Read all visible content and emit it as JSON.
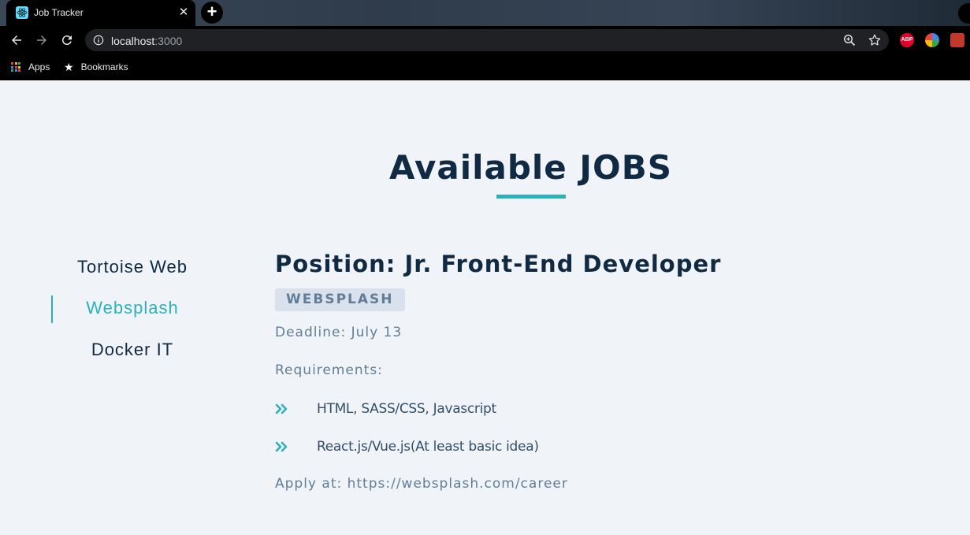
{
  "browser": {
    "tab_title": "Job Tracker",
    "url_host": "localhost",
    "url_port": ":3000",
    "bookmarks": {
      "apps_label": "Apps",
      "bookmarks_label": "Bookmarks"
    },
    "extensions": [
      "abp-icon",
      "chrome-ext-icon",
      "ext-red-icon"
    ],
    "abp_label": "ABP"
  },
  "page": {
    "title": "Available JOBS",
    "companies": [
      {
        "label": "Tortoise Web",
        "active": false
      },
      {
        "label": "Websplash",
        "active": true
      },
      {
        "label": "Docker IT",
        "active": false
      }
    ],
    "job": {
      "position": "Position: Jr. Front-End Developer",
      "company_badge": "WEBSPLASH",
      "deadline": "Deadline: July 13",
      "requirements_label": "Requirements:",
      "requirements": [
        "HTML, SASS/CSS, Javascript",
        "React.js/Vue.js(At least basic idea)"
      ],
      "apply": "Apply at: https://websplash.com/career"
    }
  },
  "colors": {
    "accent": "#2cb1bc",
    "heading": "#102a43",
    "muted": "#617d98",
    "background": "#f0f4f8",
    "badge_bg": "#d9e2ec"
  }
}
